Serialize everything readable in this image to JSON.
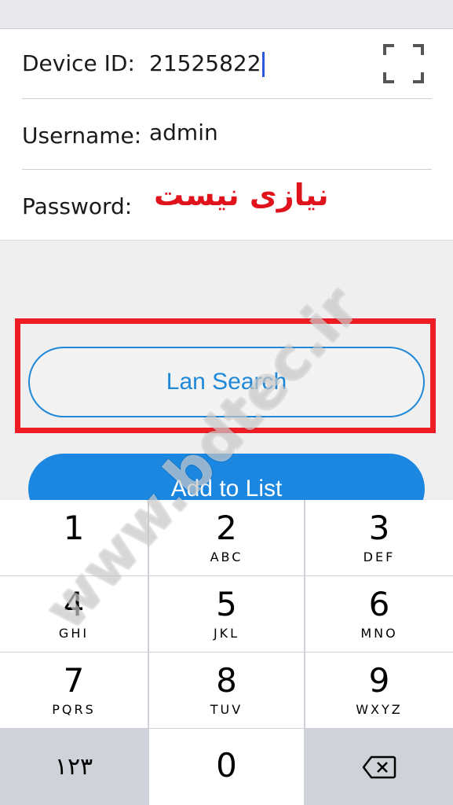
{
  "form": {
    "device_id": {
      "label": "Device ID:",
      "value": "21525822"
    },
    "username": {
      "label": "Username:",
      "value": "admin"
    },
    "password": {
      "label": "Password:",
      "annotation": "نیازی نیست"
    }
  },
  "buttons": {
    "lan_search": "Lan Search",
    "add_to_list": "Add to List"
  },
  "keypad": {
    "keys": [
      {
        "num": "1",
        "letters": ""
      },
      {
        "num": "2",
        "letters": "ABC"
      },
      {
        "num": "3",
        "letters": "DEF"
      },
      {
        "num": "4",
        "letters": "GHI"
      },
      {
        "num": "5",
        "letters": "JKL"
      },
      {
        "num": "6",
        "letters": "MNO"
      },
      {
        "num": "7",
        "letters": "PQRS"
      },
      {
        "num": "8",
        "letters": "TUV"
      },
      {
        "num": "9",
        "letters": "WXYZ"
      },
      {
        "num": "0",
        "letters": ""
      }
    ],
    "mode_key": "١٢٣"
  },
  "watermark": "www.bdtec.ir",
  "colors": {
    "accent": "#1b87e0",
    "highlight": "#ee1c24",
    "annotation": "#e0121c"
  }
}
